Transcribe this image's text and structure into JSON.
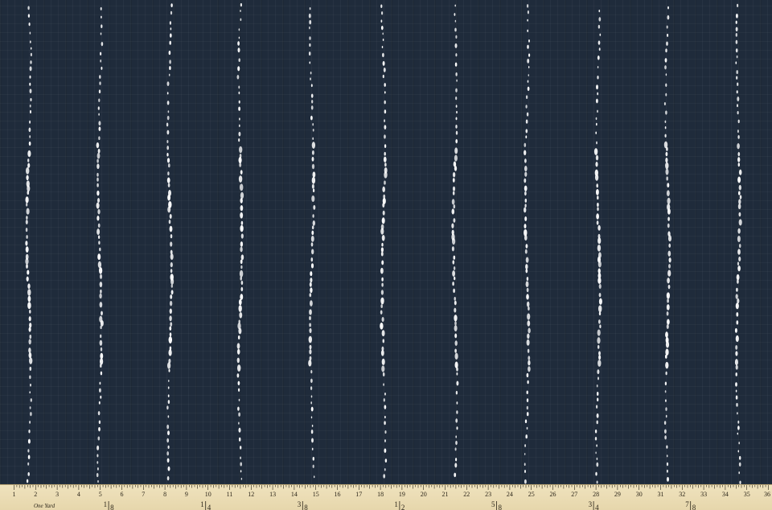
{
  "fabric": {
    "colors": {
      "background": "#1f2b3b",
      "dots": "#ffffff"
    },
    "pattern": "vertical-dotted-stripes",
    "stripe_count": 11
  },
  "ruler": {
    "colors": {
      "face": "#ece0b8",
      "ink": "#2a2418"
    },
    "script_label": "One Yard",
    "inch_labels": [
      "1",
      "2",
      "3",
      "4",
      "5",
      "6",
      "7",
      "8",
      "9",
      "10",
      "11",
      "12",
      "13",
      "14",
      "15",
      "16",
      "17",
      "18",
      "19",
      "20",
      "21",
      "22",
      "23",
      "24",
      "25",
      "26",
      "27",
      "28",
      "29",
      "30",
      "31",
      "32",
      "33",
      "34",
      "35",
      "36"
    ],
    "fraction_labels": [
      {
        "num": "1",
        "den": "8"
      },
      {
        "num": "1",
        "den": "4"
      },
      {
        "num": "3",
        "den": "8"
      },
      {
        "num": "1",
        "den": "2"
      },
      {
        "num": "5",
        "den": "8"
      },
      {
        "num": "3",
        "den": "4"
      },
      {
        "num": "7",
        "den": "8"
      }
    ]
  }
}
